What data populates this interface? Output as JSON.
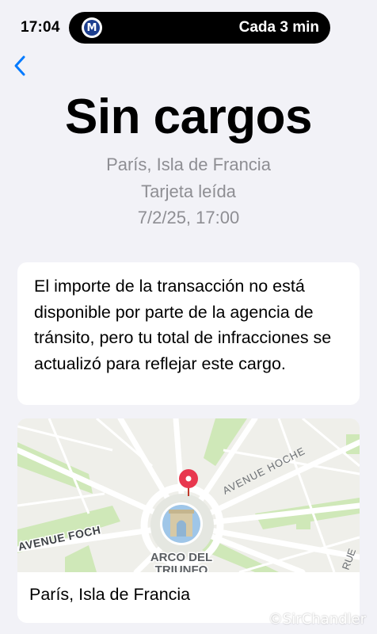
{
  "status_bar": {
    "time": "17:04",
    "live_activity": {
      "icon": "metro-logo-icon",
      "icon_letter": "M",
      "text": "Cada 3 min"
    }
  },
  "nav": {
    "back_icon": "chevron-left-icon",
    "accent_color": "#007aff"
  },
  "header": {
    "title": "Sin cargos",
    "location": "París, Isla de Francia",
    "status": "Tarjeta leída",
    "datetime": "7/2/25, 17:00"
  },
  "info_card": {
    "text": "El importe de la transacción no está disponible por parte de la agencia de tránsito, pero tu total de infracciones se actualizó para reflejar este cargo."
  },
  "map_card": {
    "streets": [
      "AVENUE HOCHE",
      "AVENUE FOCH",
      "RUE"
    ],
    "landmark_line1": "ARCO DEL",
    "landmark_line2": "TRIUNFO",
    "pin_icon": "map-pin-icon",
    "landmark_icon": "arc-de-triomphe-icon",
    "location_label": "París, Isla de Francia"
  },
  "watermark": "©SirChandler"
}
